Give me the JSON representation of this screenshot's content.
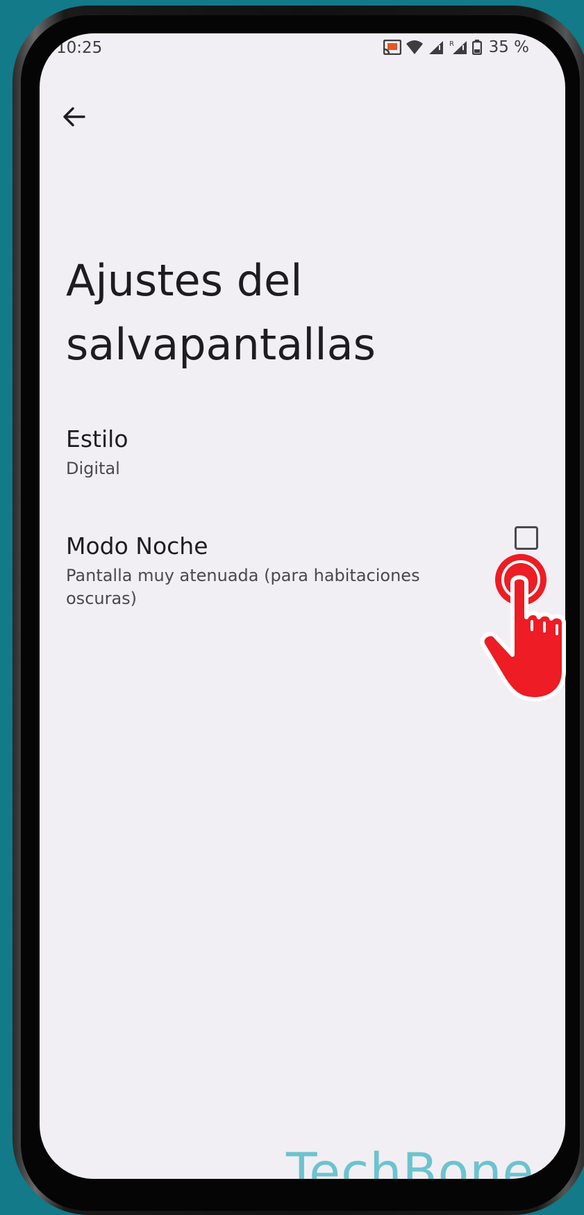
{
  "statusbar": {
    "time": "10:25",
    "battery": "35 %",
    "icons": [
      "cast-icon",
      "wifi-icon",
      "signal-icon",
      "signal-roaming-icon",
      "battery-icon"
    ]
  },
  "nav": {
    "back_icon": "arrow-left-icon"
  },
  "page": {
    "title": "Ajustes del salvapantallas"
  },
  "settings": [
    {
      "title": "Estilo",
      "summary": "Digital"
    },
    {
      "title": "Modo Noche",
      "summary": "Pantalla muy atenuada (para habitaciones oscuras)",
      "checked": false
    }
  ],
  "watermark": "TechBone",
  "colors": {
    "background": "#127a89",
    "screen": "#f1eff3",
    "text_primary": "#1d1c20",
    "text_secondary": "#4a4850",
    "touch_indicator": "#ee1c24",
    "watermark": "#6cc3cf"
  }
}
